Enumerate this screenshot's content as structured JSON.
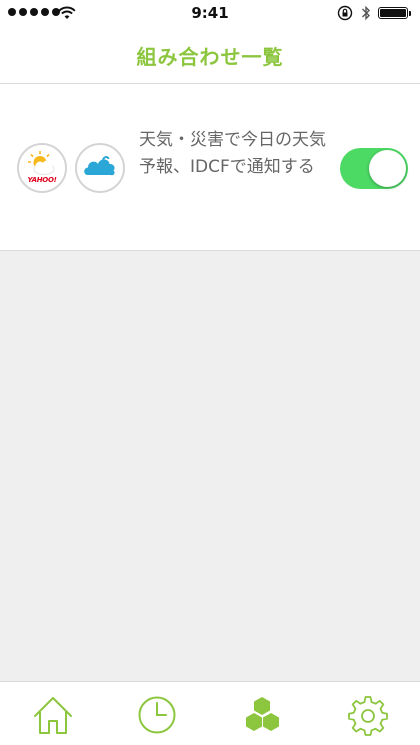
{
  "status_bar": {
    "time": "9:41"
  },
  "nav": {
    "title": "組み合わせ一覧"
  },
  "recipes": [
    {
      "trigger_icon": "yahoo-weather-icon",
      "trigger_logo_text": "YAHOO!",
      "action_icon": "idcf-cloud-icon",
      "description": "天気・災害で今日の天気予報、IDCFで通知する",
      "enabled": true
    }
  ],
  "tabs": [
    {
      "name": "home",
      "icon": "home-icon",
      "active": false
    },
    {
      "name": "history",
      "icon": "clock-icon",
      "active": false
    },
    {
      "name": "recipes",
      "icon": "cubes-icon",
      "active": true
    },
    {
      "name": "settings",
      "icon": "gear-icon",
      "active": false
    }
  ],
  "colors": {
    "accent": "#8cc63f",
    "toggle_on": "#4cd964",
    "background": "#efefef",
    "text_secondary": "#666666",
    "idcf_blue": "#2aa7d6",
    "sun_yellow": "#f6b81a"
  }
}
